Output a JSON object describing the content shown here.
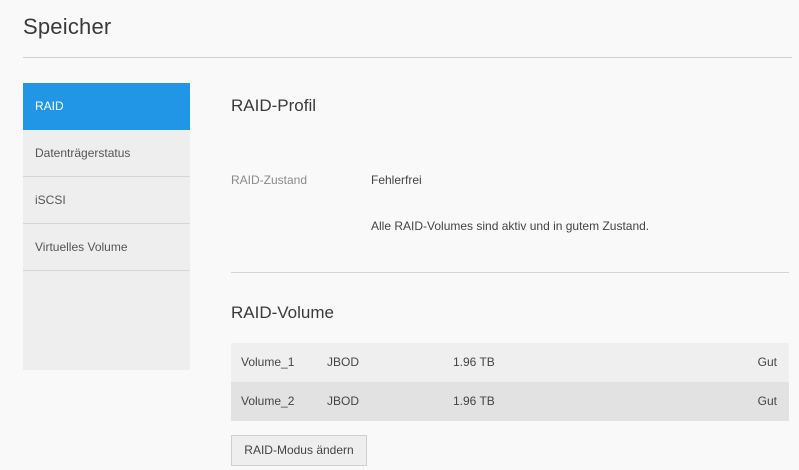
{
  "page": {
    "title": "Speicher"
  },
  "sidebar": {
    "items": [
      {
        "label": "RAID",
        "active": true
      },
      {
        "label": "Datenträgerstatus",
        "active": false
      },
      {
        "label": "iSCSI",
        "active": false
      },
      {
        "label": "Virtuelles Volume",
        "active": false
      }
    ]
  },
  "raid_profile": {
    "title": "RAID-Profil",
    "state_label": "RAID-Zustand",
    "state_value": "Fehlerfrei",
    "state_description": "Alle RAID-Volumes sind aktiv und in gutem Zustand."
  },
  "raid_volume": {
    "title": "RAID-Volume",
    "rows": [
      {
        "name": "Volume_1",
        "type": "JBOD",
        "size": "1.96 TB",
        "status": "Gut"
      },
      {
        "name": "Volume_2",
        "type": "JBOD",
        "size": "1.96 TB",
        "status": "Gut"
      }
    ],
    "change_mode_button": "RAID-Modus ändern"
  },
  "colors": {
    "accent": "#2196e6",
    "background": "#f9f9f9",
    "sidebar": "#eeeeee"
  }
}
